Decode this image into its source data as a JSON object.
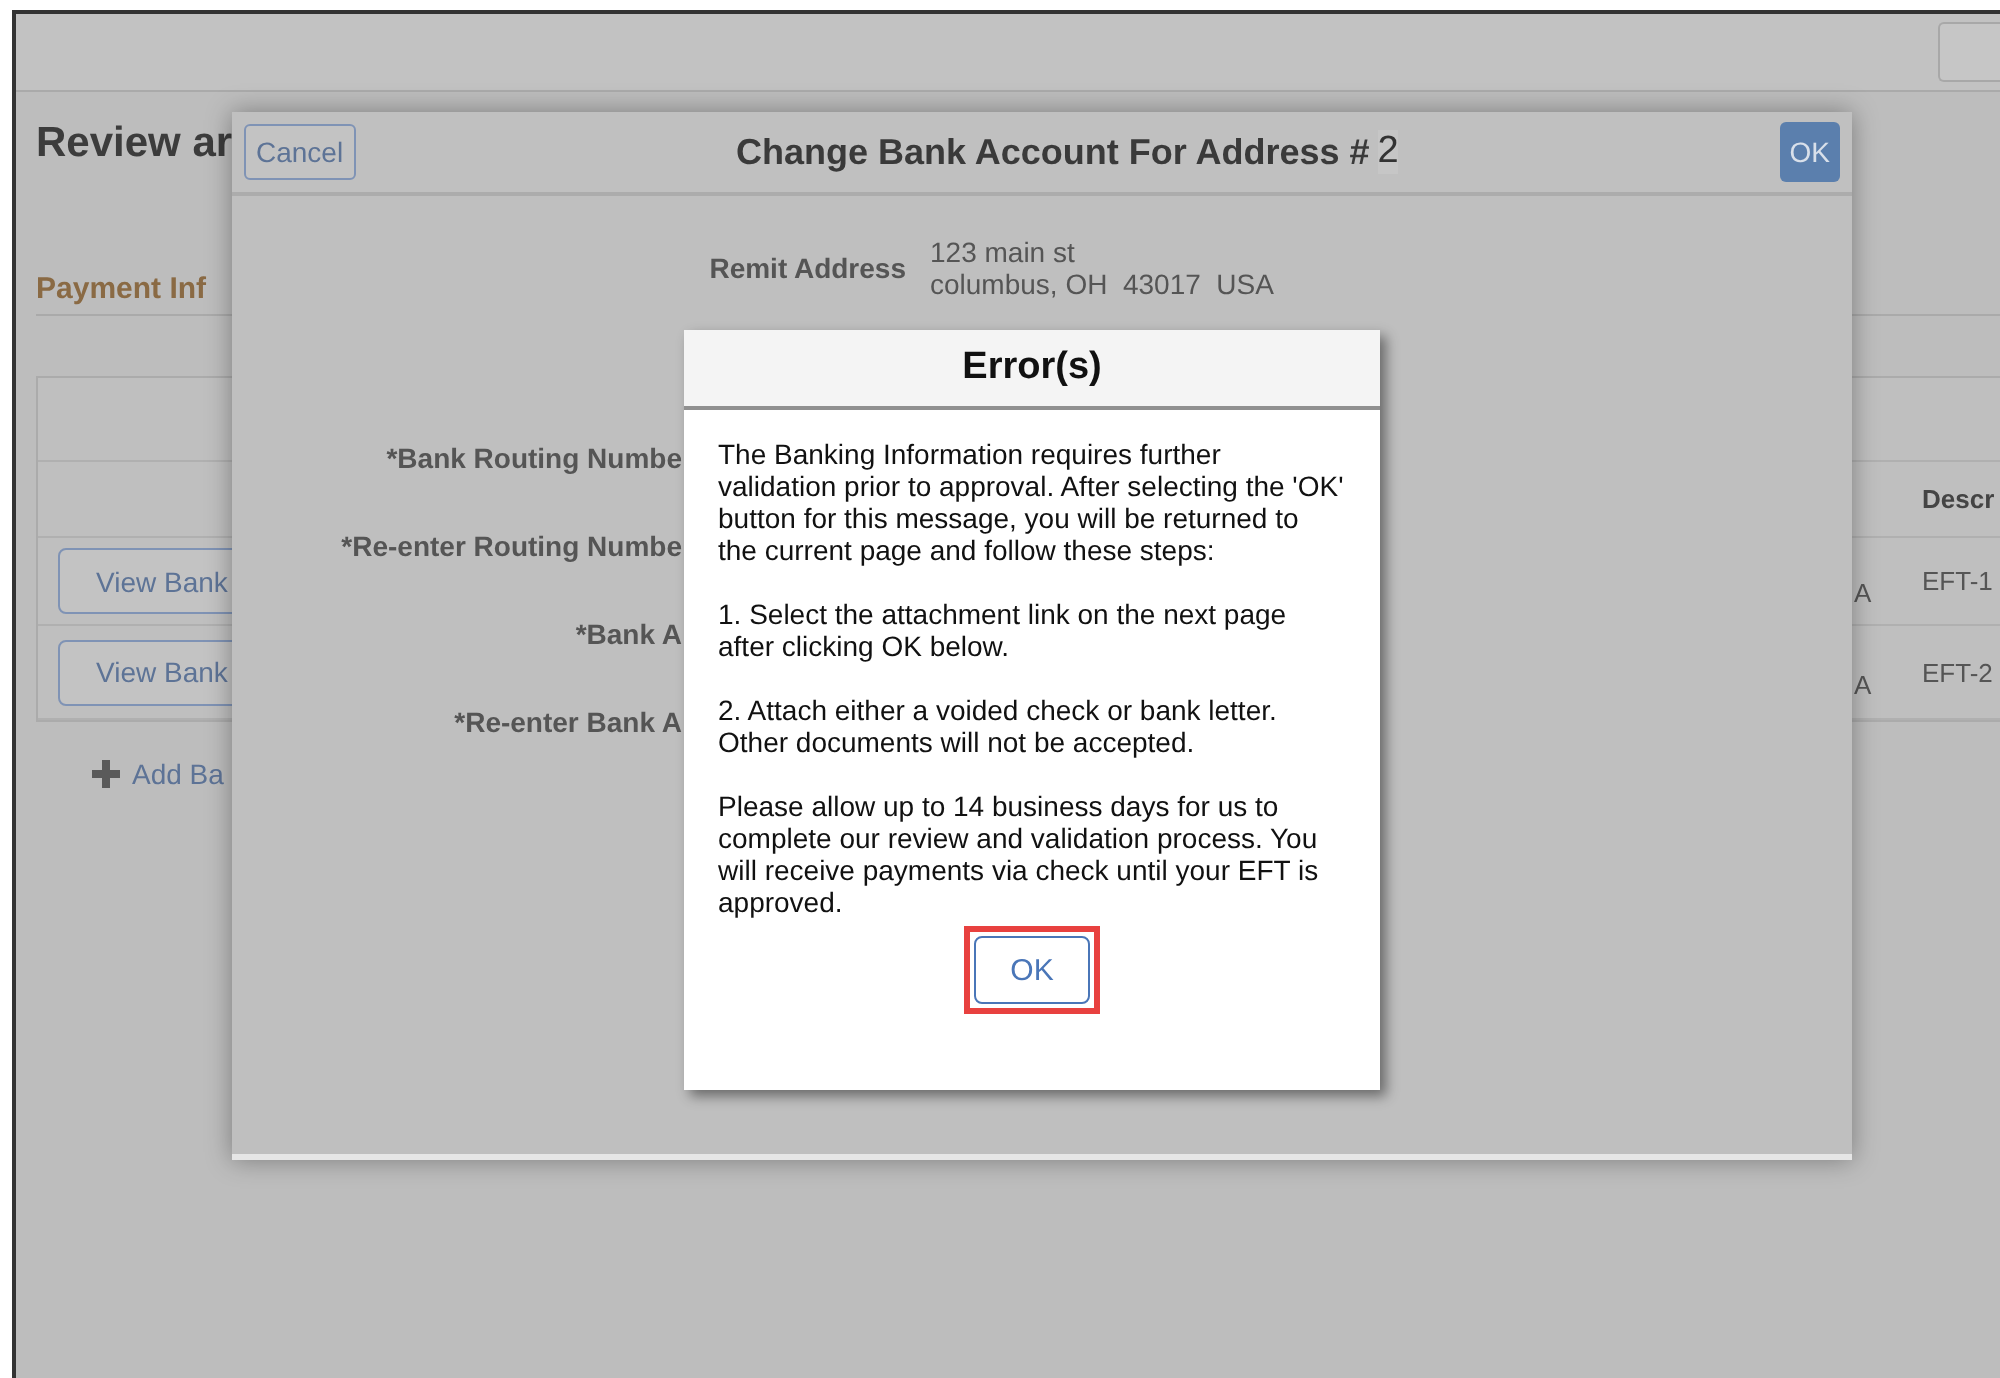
{
  "page": {
    "title": "Review ar",
    "section": "Payment Inf",
    "table": {
      "columns": [
        {
          "label": "Descr"
        }
      ],
      "rows": [
        {
          "button": "View Bank",
          "column_2": "A",
          "description": "EFT-1"
        },
        {
          "button": "View Bank",
          "column_2": "A",
          "description": "EFT-2"
        }
      ]
    },
    "add_link": "Add Ba"
  },
  "modal": {
    "cancel": "Cancel",
    "title": "Change Bank Account For Address #",
    "title_number": "2",
    "ok": "OK",
    "remit_label": "Remit Address",
    "remit_lines": [
      "123 main st",
      "columbus, OH  43017  USA"
    ],
    "fields": [
      "*Bank Routing Numbe",
      "*Re-enter Routing Numbe",
      "*Bank A",
      "*Re-enter Bank A"
    ]
  },
  "error_dialog": {
    "title": "Error(s)",
    "paragraphs": [
      "The Banking Information requires further validation prior to approval. After selecting the 'OK' button for this message, you will be returned to the current page and follow these steps:",
      "1. Select the attachment link on the next page after clicking OK below.",
      "2. Attach either a voided check or bank letter. Other documents will not be accepted.",
      "Please allow up to 14 business days for us to complete our review and validation process. You will receive payments via check until your EFT is approved."
    ],
    "ok": "OK",
    "ok_highlighted": true
  }
}
